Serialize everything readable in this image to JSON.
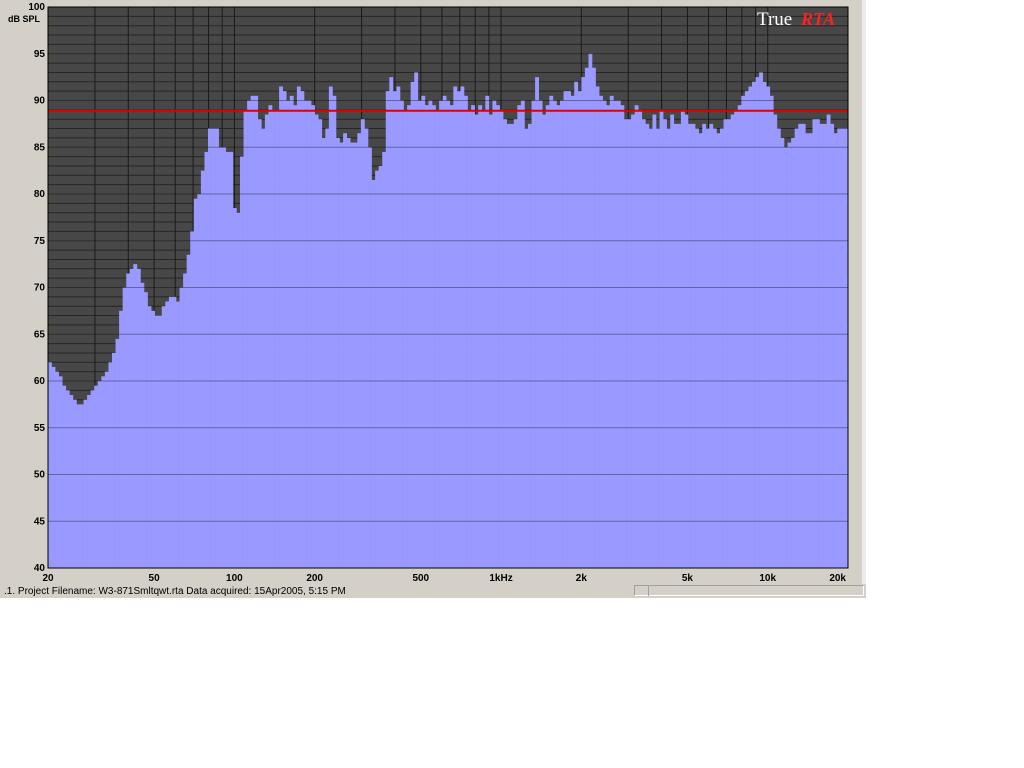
{
  "window": {
    "status_text": ".1. Project Filename: W3-871Smltqwt.rta Data acquired: 15Apr2005, 5:15 PM",
    "brand_true": "True",
    "brand_rta": "RTA"
  },
  "colors": {
    "plot_bg": "#474747",
    "bars": "#9999ff",
    "reference_line": "#e00000",
    "window_bg": "#d4d0c8",
    "grid": "#000000"
  },
  "chart_data": {
    "type": "bar",
    "title": "",
    "ylabel": "dB SPL",
    "xlabel": "",
    "ylim": [
      40,
      100
    ],
    "xlim": [
      20,
      20000
    ],
    "x_scale": "log",
    "y_ticks": [
      "100",
      "95",
      "90",
      "85",
      "80",
      "75",
      "70",
      "65",
      "60",
      "55",
      "50",
      "45",
      "40"
    ],
    "x_ticks": [
      {
        "value": 20,
        "label": "20"
      },
      {
        "value": 50,
        "label": "50"
      },
      {
        "value": 100,
        "label": "100"
      },
      {
        "value": 200,
        "label": "200"
      },
      {
        "value": 500,
        "label": "500"
      },
      {
        "value": 1000,
        "label": "1kHz"
      },
      {
        "value": 2000,
        "label": "2k"
      },
      {
        "value": 5000,
        "label": "5k"
      },
      {
        "value": 10000,
        "label": "10k"
      },
      {
        "value": 20000,
        "label": "20k"
      }
    ],
    "reference_level": 88.9,
    "grid": true,
    "bands_per_octave": 24,
    "values": [
      62,
      61.5,
      61,
      60.5,
      59.5,
      59,
      58.5,
      58,
      57.5,
      57.5,
      58,
      58.5,
      59,
      59.5,
      60,
      60.5,
      61,
      62,
      63,
      64.5,
      67.5,
      70,
      71.5,
      72,
      72.5,
      72,
      70.5,
      69.5,
      68,
      67.5,
      67,
      67,
      68,
      68.5,
      69,
      69,
      68.5,
      70,
      71.5,
      73.5,
      76,
      79.5,
      80,
      82.5,
      84.5,
      87,
      87,
      87,
      85,
      85,
      84.5,
      84.5,
      78.5,
      78,
      84,
      89,
      90,
      90.5,
      90.5,
      88,
      87,
      88.5,
      89.5,
      89,
      89,
      91.5,
      91,
      90,
      90.5,
      89.5,
      91.5,
      91,
      90,
      90,
      89.5,
      88.5,
      88,
      86,
      87,
      91.5,
      90.5,
      86,
      85.5,
      86.5,
      86,
      85.5,
      85.5,
      86.5,
      88,
      87,
      85,
      81.5,
      82.5,
      83,
      84.5,
      91,
      92.5,
      91,
      91.5,
      90,
      89,
      89.5,
      92,
      93,
      90,
      90.5,
      89.5,
      90,
      89.5,
      89,
      90,
      90.5,
      90,
      89.5,
      91.5,
      91,
      91.5,
      90.5,
      89,
      89.5,
      88.5,
      89.5,
      89,
      90.5,
      88.5,
      90,
      89.5,
      89,
      88,
      87.5,
      87.5,
      88,
      89.5,
      90,
      87,
      87.5,
      90,
      92.5,
      90,
      88.5,
      89.5,
      90.5,
      90,
      89.5,
      90,
      91,
      91,
      90.5,
      92,
      91,
      92.5,
      93.5,
      95,
      93.5,
      91.5,
      90.5,
      90,
      89.5,
      90.5,
      90,
      90,
      89.5,
      88,
      88,
      88.5,
      89.5,
      89,
      88,
      87.5,
      87,
      88.5,
      87,
      89,
      88,
      87,
      88.5,
      87.5,
      87.5,
      89,
      88.5,
      87.5,
      87.5,
      87,
      86.5,
      87.5,
      87,
      87.5,
      87,
      86.5,
      87,
      88,
      88,
      88.5,
      89,
      89.5,
      90.5,
      91,
      91.5,
      92,
      92.5,
      93,
      92,
      91.5,
      90.5,
      88.5,
      87,
      86,
      85,
      85.5,
      86,
      87,
      87.5,
      87.5,
      86.5,
      86.5,
      88,
      88,
      87.5,
      87.5,
      88.5,
      87.5,
      86.5,
      87,
      87,
      87
    ]
  }
}
